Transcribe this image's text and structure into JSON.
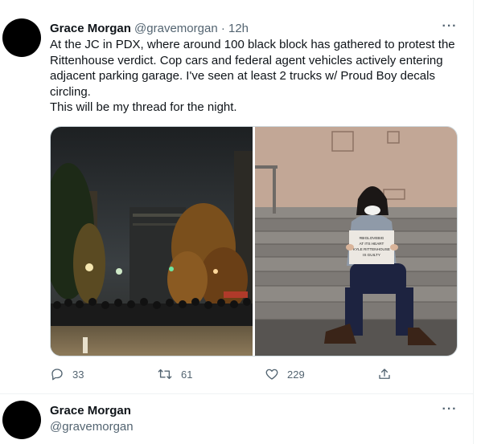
{
  "tweet": {
    "author_name": "Grace Morgan",
    "handle": "@gravemorgan",
    "separator": "·",
    "time": "12h",
    "more_glyph": "···",
    "text_lines": [
      "At the JC in PDX, where around 100 black block has gathered to protest the",
      "Rittenhouse verdict. Cop cars and federal agent vehicles actively entering",
      "adjacent parking garage. I've seen at least 2 trucks w/ Proud Boy decals",
      "circling.",
      "This will be my thread for the night."
    ],
    "media": {
      "photo_left_icon": "night-street-protest-photo",
      "photo_right_icon": "woman-sitting-on-steps-photo",
      "sign_text": [
        "#BIGLOVEBIG",
        "AT ITS HEART",
        "KYLE RITTENHOUSE",
        "IS GUILTY"
      ]
    },
    "actions": {
      "reply_count": "33",
      "retweet_count": "61",
      "like_count": "229",
      "reply_icon": "reply-icon",
      "retweet_icon": "retweet-icon",
      "like_icon": "heart-icon",
      "share_icon": "share-icon"
    }
  },
  "next_tweet": {
    "author_name": "Grace Morgan",
    "handle": "@gravemorgan",
    "more_glyph": "···"
  },
  "colors": {
    "text_primary": "#0f1419",
    "text_secondary": "#536471",
    "border": "#cfd9de"
  }
}
